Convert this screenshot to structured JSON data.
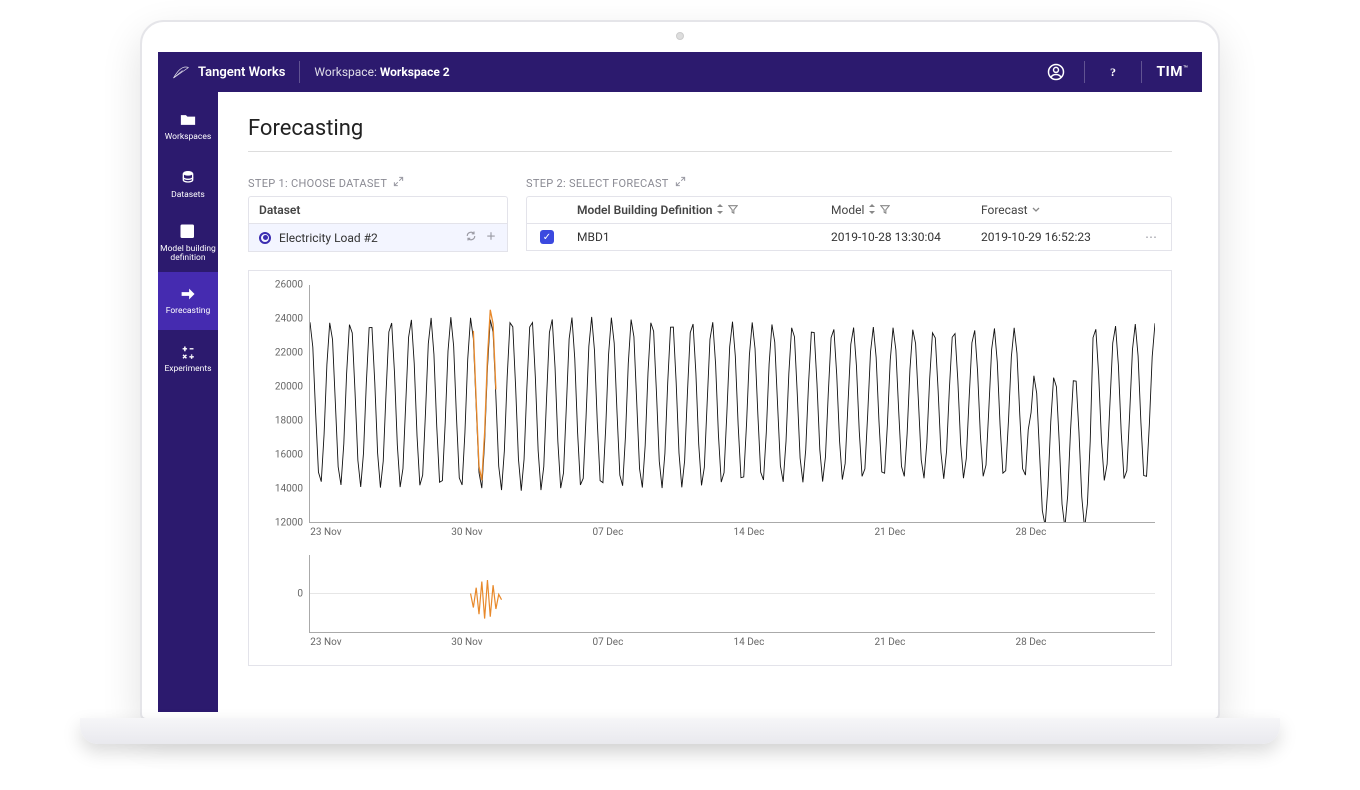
{
  "brand": "Tangent Works",
  "workspace_label": "Workspace:",
  "workspace_name": "Workspace 2",
  "tim_brand": "TIM",
  "tim_tm": "™",
  "sidebar": {
    "items": [
      {
        "label": "Workspaces"
      },
      {
        "label": "Datasets"
      },
      {
        "label": "Model building definition"
      },
      {
        "label": "Forecasting"
      },
      {
        "label": "Experiments"
      }
    ]
  },
  "page_title": "Forecasting",
  "step1": {
    "title": "STEP 1: CHOOSE DATASET",
    "header": "Dataset",
    "selected_dataset": "Electricity Load #2"
  },
  "step2": {
    "title": "STEP 2: SELECT FORECAST",
    "headers": {
      "mbd": "Model Building Definition",
      "model": "Model",
      "forecast": "Forecast"
    },
    "row": {
      "mbd": "MBD1",
      "model": "2019-10-28 13:30:04",
      "forecast": "2019-10-29 16:52:23"
    }
  },
  "chart_data": [
    {
      "type": "line",
      "title": "",
      "xlabel": "",
      "ylabel": "",
      "ylim": [
        12000,
        26000
      ],
      "y_ticks": [
        12000,
        14000,
        16000,
        18000,
        20000,
        22000,
        24000,
        26000
      ],
      "x_tick_labels": [
        "23 Nov",
        "30 Nov",
        "07 Dec",
        "14 Dec",
        "21 Dec",
        "28 Dec"
      ],
      "series": [
        {
          "name": "actual",
          "color": "#111111",
          "x_index_range": [
            0,
            300
          ],
          "values_approx": "daily-cycle oscillation roughly between 14000 and 24000 with ~42 cycles across the x-range; dip to ~12500 around 26–27 Dec"
        },
        {
          "name": "forecast-segment",
          "color": "#e8892b",
          "x_index_range": [
            57,
            63
          ],
          "values_approx": "overlay segment around 30 Nov peaking near 25000 and troughing near 16000"
        }
      ]
    },
    {
      "type": "line",
      "title": "",
      "xlabel": "",
      "ylabel": "",
      "ylim": [
        -1000,
        1000
      ],
      "y_ticks": [
        0
      ],
      "x_tick_labels": [
        "23 Nov",
        "30 Nov",
        "07 Dec",
        "14 Dec",
        "21 Dec",
        "28 Dec"
      ],
      "series": [
        {
          "name": "residual",
          "color": "#e8892b",
          "x_index_range": [
            57,
            63
          ],
          "values_approx": "short noisy segment around 30 Nov oscillating roughly between -800 and 400"
        }
      ]
    }
  ]
}
